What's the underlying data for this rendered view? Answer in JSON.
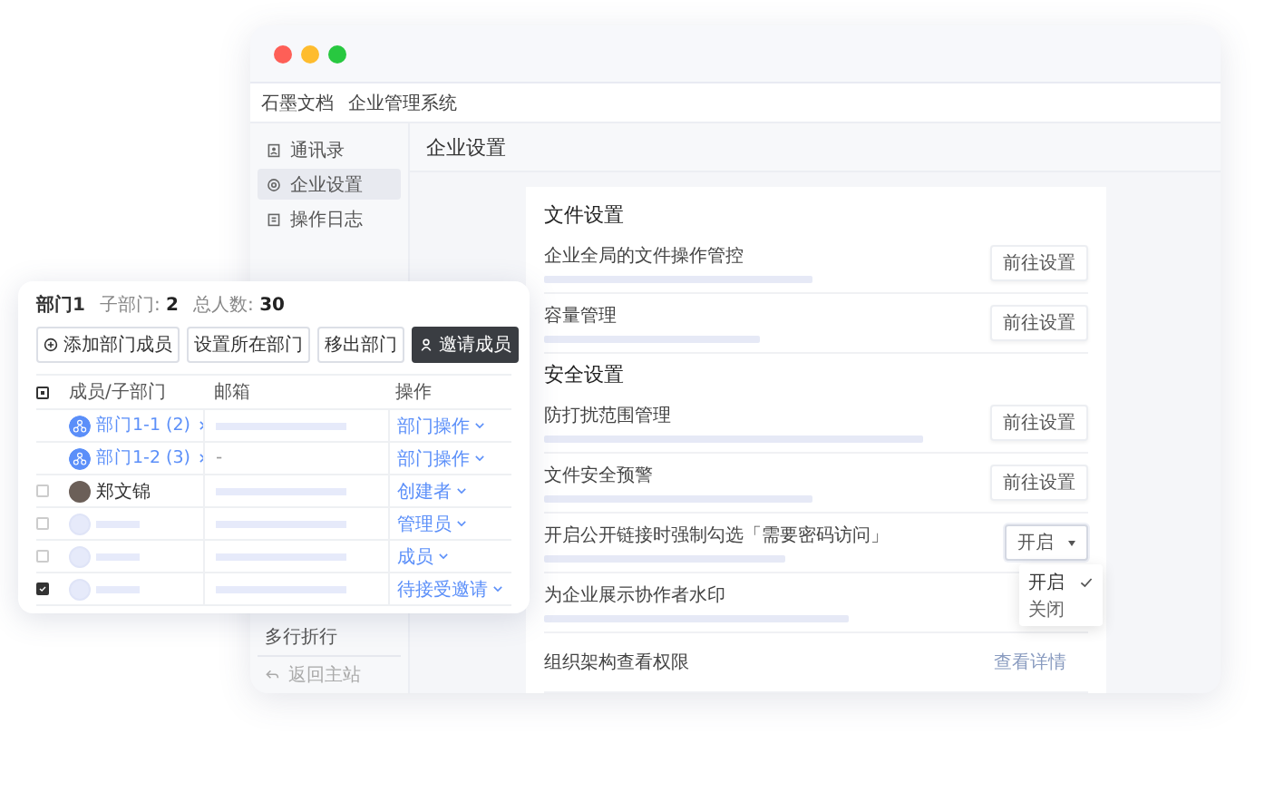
{
  "main_window": {
    "app_name": "石墨文档",
    "app_subtitle": "企业管理系统",
    "sidebar": {
      "items": [
        {
          "label": "通讯录",
          "selected": false
        },
        {
          "label": "企业设置",
          "selected": true
        },
        {
          "label": "操作日志",
          "selected": false
        }
      ],
      "footer": [
        {
          "label": "多行折行",
          "kind": "text"
        },
        {
          "label": "返回主站",
          "kind": "back"
        }
      ]
    },
    "page_title": "企业设置",
    "sections": [
      {
        "title": "文件设置",
        "rows": [
          {
            "kind": "button",
            "label": "企业全局的文件操作管控",
            "action": "前往设置"
          },
          {
            "kind": "button",
            "label": "容量管理",
            "action": "前往设置"
          }
        ]
      },
      {
        "title": "安全设置",
        "rows": [
          {
            "kind": "button",
            "label": "防打扰范围管理",
            "action": "前往设置"
          },
          {
            "kind": "button",
            "label": "文件安全预警",
            "action": "前往设置"
          },
          {
            "kind": "dropdown",
            "label": "开启公开链接时强制勾选「需要密码访问」",
            "value": "开启",
            "expanded": true,
            "options": [
              {
                "label": "开启",
                "selected": true
              },
              {
                "label": "关闭",
                "selected": false
              }
            ]
          },
          {
            "kind": "none",
            "label": "为企业展示协作者水印"
          },
          {
            "kind": "link",
            "label": "组织架构查看权限",
            "action": "查看详情"
          }
        ]
      }
    ]
  },
  "department_card": {
    "title": "部门1",
    "stats": [
      {
        "label": "子部门:",
        "value": "2"
      },
      {
        "label": "总人数:",
        "value": "30"
      }
    ],
    "buttons": [
      {
        "label": "添加部门成员",
        "kind": "add"
      },
      {
        "label": "设置所在部门",
        "kind": "plain"
      },
      {
        "label": "移出部门",
        "kind": "plain"
      },
      {
        "label": "邀请成员",
        "kind": "invite"
      }
    ],
    "header_checkbox": {
      "indeterminate": true
    },
    "columns": [
      "成员/子部门",
      "邮箱",
      "操作"
    ],
    "rows": [
      {
        "kind": "department",
        "name": "部门1-1 (2)",
        "action": "部门操作"
      },
      {
        "kind": "department",
        "name": "部门1-2 (3)",
        "email": "-",
        "action": "部门操作"
      },
      {
        "kind": "member",
        "name": "郑文锦",
        "checked": false,
        "action": "创建者"
      },
      {
        "kind": "member",
        "checked": false,
        "action": "管理员"
      },
      {
        "kind": "member",
        "checked": false,
        "action": "成员"
      },
      {
        "kind": "member",
        "checked": true,
        "action": "待接受邀请"
      }
    ]
  }
}
